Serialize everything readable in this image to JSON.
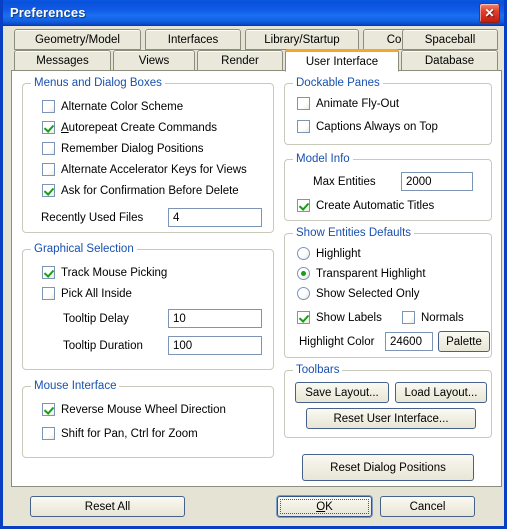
{
  "window": {
    "title": "Preferences",
    "close_icon": "close-icon"
  },
  "tabs": {
    "row1": [
      {
        "label": "Geometry/Model",
        "active": false
      },
      {
        "label": "Interfaces",
        "active": false
      },
      {
        "label": "Library/Startup",
        "active": false
      },
      {
        "label": "Color",
        "active": false
      },
      {
        "label": "Spaceball",
        "active": false
      }
    ],
    "row2": [
      {
        "label": "Messages",
        "active": false
      },
      {
        "label": "Views",
        "active": false
      },
      {
        "label": "Render",
        "active": false
      },
      {
        "label": "User Interface",
        "active": true
      },
      {
        "label": "Database",
        "active": false
      }
    ]
  },
  "menus_and_dialog_boxes": {
    "legend": "Menus and Dialog Boxes",
    "checkboxes": [
      {
        "label": "Alternate Color Scheme",
        "checked": false
      },
      {
        "label": "Autorepeat Create Commands",
        "checked": true,
        "accel": "A"
      },
      {
        "label": "Remember Dialog Positions",
        "checked": false
      },
      {
        "label": "Alternate Accelerator Keys for Views",
        "checked": false
      },
      {
        "label": "Ask for Confirmation Before Delete",
        "checked": true
      }
    ],
    "recently_used_files_label": "Recently Used Files",
    "recently_used_files_value": "4"
  },
  "graphical_selection": {
    "legend": "Graphical Selection",
    "checkboxes": [
      {
        "label": "Track Mouse Picking",
        "checked": true
      },
      {
        "label": "Pick All Inside",
        "checked": false
      }
    ],
    "tooltip_delay_label": "Tooltip Delay",
    "tooltip_delay_value": "10",
    "tooltip_duration_label": "Tooltip Duration",
    "tooltip_duration_value": "100"
  },
  "mouse_interface": {
    "legend": "Mouse Interface",
    "checkboxes": [
      {
        "label": "Reverse Mouse Wheel Direction",
        "checked": true
      },
      {
        "label": "Shift for Pan, Ctrl for Zoom",
        "checked": false
      }
    ]
  },
  "dockable_panes": {
    "legend": "Dockable Panes",
    "checkboxes": [
      {
        "label": "Animate Fly-Out",
        "checked": false
      },
      {
        "label": "Captions Always on Top",
        "checked": false
      }
    ]
  },
  "model_info": {
    "legend": "Model Info",
    "max_entities_label": "Max Entities",
    "max_entities_value": "2000",
    "create_automatic_titles": {
      "label": "Create Automatic Titles",
      "checked": true
    }
  },
  "show_entities_defaults": {
    "legend": "Show Entities Defaults",
    "radios": [
      {
        "label": "Highlight",
        "selected": false
      },
      {
        "label": "Transparent Highlight",
        "selected": true
      },
      {
        "label": "Show Selected Only",
        "selected": false
      }
    ],
    "show_labels": {
      "label": "Show Labels",
      "checked": true
    },
    "normals": {
      "label": "Normals",
      "checked": false
    },
    "highlight_color_label": "Highlight Color",
    "highlight_color_value": "24600",
    "palette_button": "Palette"
  },
  "toolbars": {
    "legend": "Toolbars",
    "save_layout": "Save Layout...",
    "load_layout": "Load Layout...",
    "reset_user_interface": "Reset User Interface..."
  },
  "reset_dialog_positions": "Reset Dialog Positions",
  "footer": {
    "reset_all": "Reset All",
    "ok": "OK",
    "ok_accel": "O",
    "cancel": "Cancel"
  },
  "colors": {
    "titlebar_blue": "#0f5ce8",
    "window_border": "#0a3fc4",
    "dialog_face": "#e4e3d4",
    "panel": "#ffffff",
    "legend_text": "#1850b0",
    "active_tab_accent": "#f0a830",
    "check_green": "#17a017",
    "close_red": "#c41c10"
  }
}
